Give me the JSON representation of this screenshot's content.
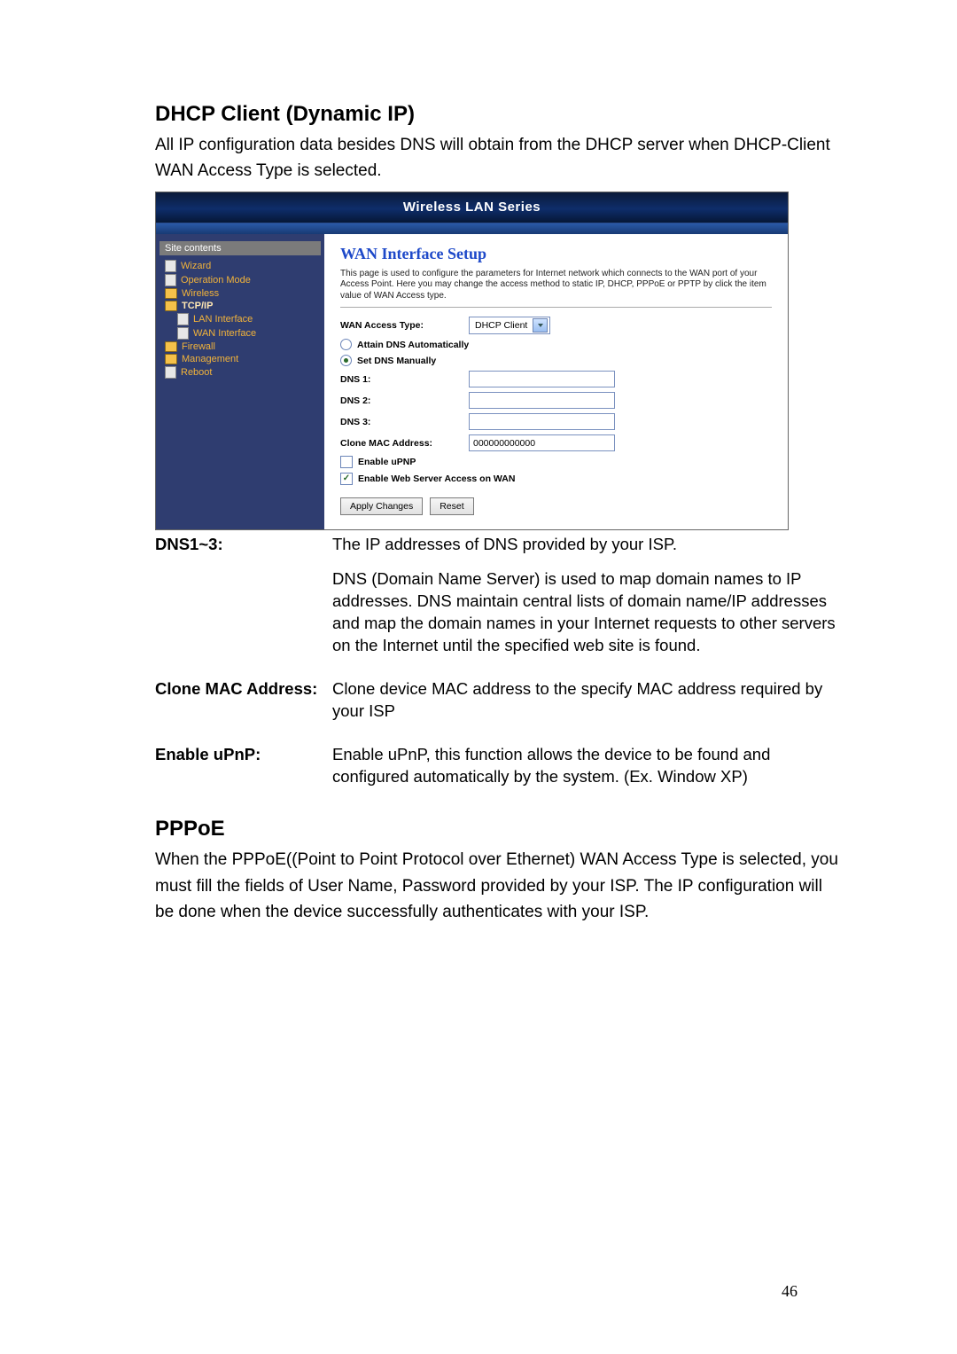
{
  "section1": {
    "title": "DHCP Client (Dynamic IP)",
    "intro": "All IP configuration data besides DNS will obtain from the DHCP server when DHCP-Client WAN Access Type is selected."
  },
  "shot": {
    "header": "Wireless LAN Series",
    "sidebar_root": "Site contents",
    "sidebar": [
      {
        "label": "Wizard",
        "level": 1,
        "type": "doc"
      },
      {
        "label": "Operation Mode",
        "level": 1,
        "type": "doc"
      },
      {
        "label": "Wireless",
        "level": 1,
        "type": "folder"
      },
      {
        "label": "TCP/IP",
        "level": 1,
        "type": "folder",
        "active": true
      },
      {
        "label": "LAN Interface",
        "level": 2,
        "type": "doc"
      },
      {
        "label": "WAN Interface",
        "level": 2,
        "type": "doc"
      },
      {
        "label": "Firewall",
        "level": 1,
        "type": "folder"
      },
      {
        "label": "Management",
        "level": 1,
        "type": "folder"
      },
      {
        "label": "Reboot",
        "level": 1,
        "type": "doc"
      }
    ],
    "panel": {
      "title": "WAN Interface Setup",
      "desc": "This page is used to configure the parameters for Internet network which connects to the WAN port of your Access Point. Here you may change the access method to static IP, DHCP, PPPoE or PPTP by click the item value of WAN Access type.",
      "access_label": "WAN Access Type:",
      "access_value": "DHCP Client",
      "attain_dns": "Attain DNS Automatically",
      "set_dns": "Set DNS Manually",
      "dns1_label": "DNS 1:",
      "dns2_label": "DNS 2:",
      "dns3_label": "DNS 3:",
      "clone_label": "Clone MAC Address:",
      "clone_value": "000000000000",
      "enable_upnp": "Enable uPNP",
      "enable_wan": "Enable Web Server Access on WAN",
      "apply": "Apply Changes",
      "reset": "Reset"
    }
  },
  "defs": {
    "dns_term": "DNS1~3:",
    "dns_p1": "The IP addresses of DNS provided by your ISP.",
    "dns_p2": "DNS (Domain Name Server) is used to map domain names to IP addresses. DNS maintain central lists of domain name/IP addresses and map the domain names in your Internet requests to other servers on the Internet until the specified web site is found.",
    "clone_term": "Clone MAC Address:",
    "clone_body": "Clone device MAC address to the specify MAC address required by your ISP",
    "upnp_term": "Enable uPnP:",
    "upnp_body": "Enable uPnP, this function allows the device to be found and configured automatically by the system. (Ex. Window XP)"
  },
  "section2": {
    "title": "PPPoE",
    "intro": "When the PPPoE((Point to Point Protocol over Ethernet) WAN Access Type is selected, you must fill the fields of User Name, Password provided by your ISP. The IP configuration will be done when the device successfully authenticates with your ISP."
  },
  "page_number": "46"
}
